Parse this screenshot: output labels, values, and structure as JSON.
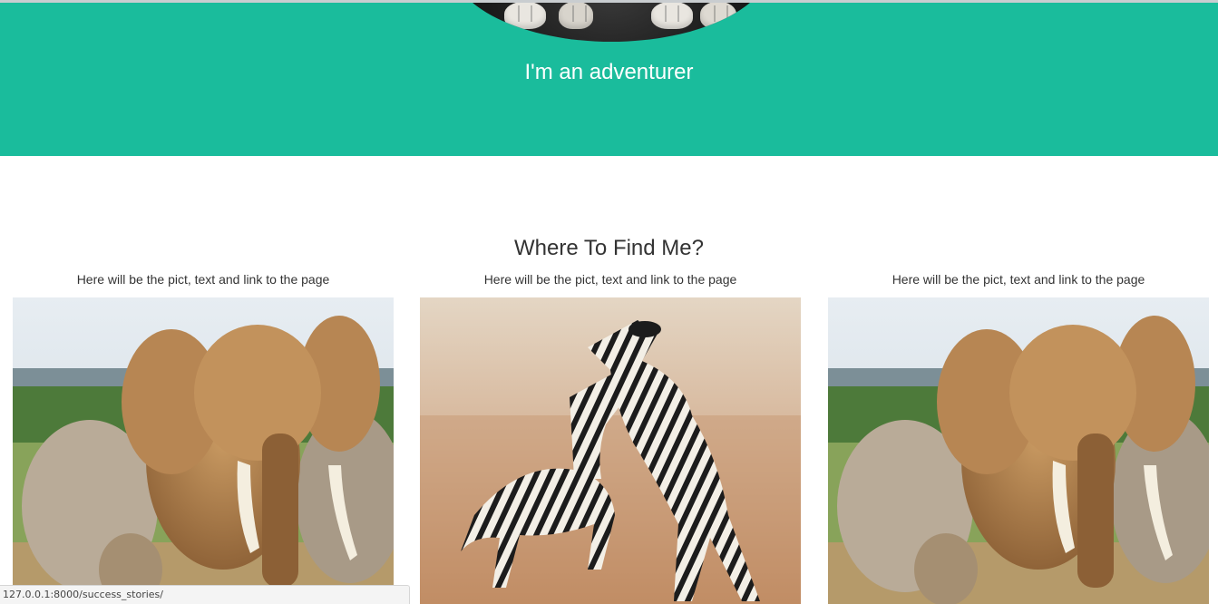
{
  "hero": {
    "title": "I'm an adventurer",
    "background_color": "#1abc9c",
    "avatar": "cat-photo"
  },
  "section": {
    "title": "Where To Find Me?"
  },
  "cards": [
    {
      "caption": "Here will be the pict, text and link to the page",
      "image": "elephant-herd-photo"
    },
    {
      "caption": "Here will be the pict, text and link to the page",
      "image": "zebras-sparring-photo"
    },
    {
      "caption": "Here will be the pict, text and link to the page",
      "image": "elephant-herd-photo"
    }
  ],
  "status_bar": {
    "url": "127.0.0.1:8000/success_stories/"
  }
}
